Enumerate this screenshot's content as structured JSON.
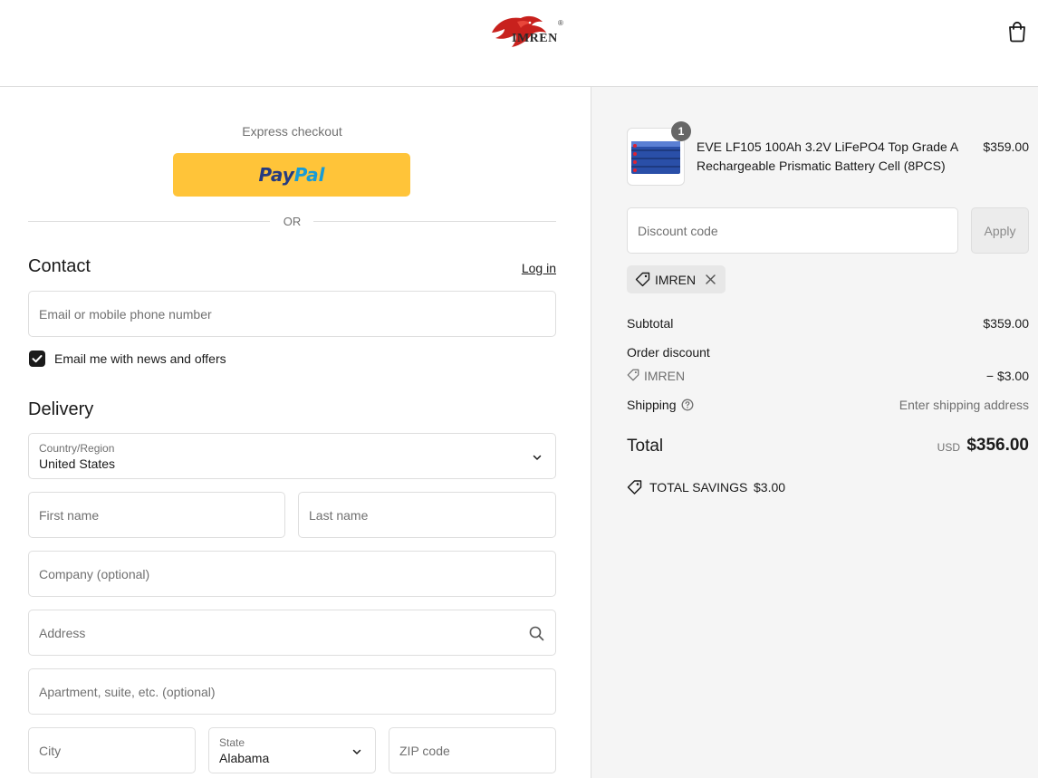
{
  "header": {
    "brand": "IMREN",
    "reg_mark": "®"
  },
  "express": {
    "title": "Express checkout",
    "paypal_part1": "Pay",
    "paypal_part2": "Pal",
    "or_text": "OR"
  },
  "contact": {
    "title": "Contact",
    "login_label": "Log in",
    "email_placeholder": "Email or mobile phone number",
    "newsletter_label": "Email me with news and offers",
    "newsletter_checked": true
  },
  "delivery": {
    "title": "Delivery",
    "country_label": "Country/Region",
    "country_value": "United States",
    "first_name_placeholder": "First name",
    "last_name_placeholder": "Last name",
    "company_placeholder": "Company (optional)",
    "address_placeholder": "Address",
    "apartment_placeholder": "Apartment, suite, etc. (optional)",
    "city_placeholder": "City",
    "state_label": "State",
    "state_value": "Alabama",
    "zip_placeholder": "ZIP code"
  },
  "summary": {
    "product": {
      "quantity": "1",
      "name": "EVE LF105 100Ah 3.2V LiFePO4 Top Grade A Rechargeable Prismatic Battery Cell (8PCS)",
      "price": "$359.00"
    },
    "discount_placeholder": "Discount code",
    "apply_label": "Apply",
    "applied_code": "IMREN",
    "subtotal_label": "Subtotal",
    "subtotal_value": "$359.00",
    "order_discount_label": "Order discount",
    "order_discount_code": "IMREN",
    "order_discount_value": "− $3.00",
    "shipping_label": "Shipping",
    "shipping_value": "Enter shipping address",
    "total_label": "Total",
    "total_currency": "USD",
    "total_value": "$356.00",
    "savings_label": "TOTAL SAVINGS",
    "savings_value": "$3.00"
  },
  "colors": {
    "paypal_yellow": "#ffc439",
    "panel_bg": "#f5f5f5",
    "brand_red": "#c8211d"
  }
}
